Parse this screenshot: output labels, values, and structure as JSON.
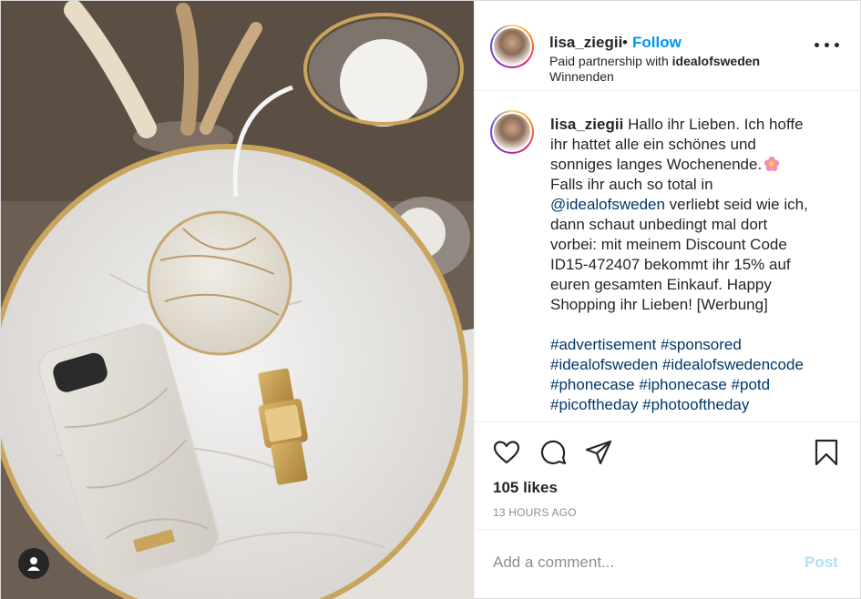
{
  "post": {
    "image_alt": "",
    "user_tag_icon": "user-tag-icon"
  },
  "header": {
    "username": "lisa_ziegii",
    "separator": "•",
    "follow_label": "Follow",
    "partnership_prefix": "Paid partnership with",
    "partner_name": "idealofsweden",
    "location": "Winnenden",
    "more_icon": "more-options-icon"
  },
  "caption": {
    "username": "lisa_ziegii",
    "line1": "Hallo ihr Lieben. Ich hoffe",
    "line2": "ihr hattet alle ein schönes und",
    "line3": "sonniges langes Wochenende.",
    "line4": "Falls ihr auch so total in",
    "mention": "@idealofsweden",
    "line5_rest": " verliebt seid wie ich,",
    "line6": "dann schaut unbedingt mal dort",
    "line7": "vorbei: mit meinem Discount Code",
    "line8": "ID15-472407 bekommt ihr 15% auf",
    "line9": "euren gesamten Einkauf. Happy",
    "line10": "Shopping ihr Lieben! [Werbung]",
    "hashtags": [
      [
        "#advertisement",
        "#sponsored"
      ],
      [
        "#idealofsweden",
        "#idealofswedencode"
      ],
      [
        "#phonecase",
        "#iphonecase",
        "#potd"
      ],
      [
        "#picoftheday",
        "#photooftheday"
      ]
    ],
    "emoji_icon": "flower-emoji-icon"
  },
  "actions": {
    "like_icon": "heart-icon",
    "comment_icon": "comment-icon",
    "share_icon": "share-icon",
    "save_icon": "bookmark-icon",
    "likes_text": "105 likes",
    "timestamp": "13 HOURS AGO"
  },
  "comment": {
    "placeholder": "Add a comment...",
    "post_label": "Post"
  },
  "colors": {
    "link_blue": "#0095f6",
    "hashtag": "#00376b",
    "post_disabled": "#b2dffc",
    "muted": "#8e8e8e"
  }
}
